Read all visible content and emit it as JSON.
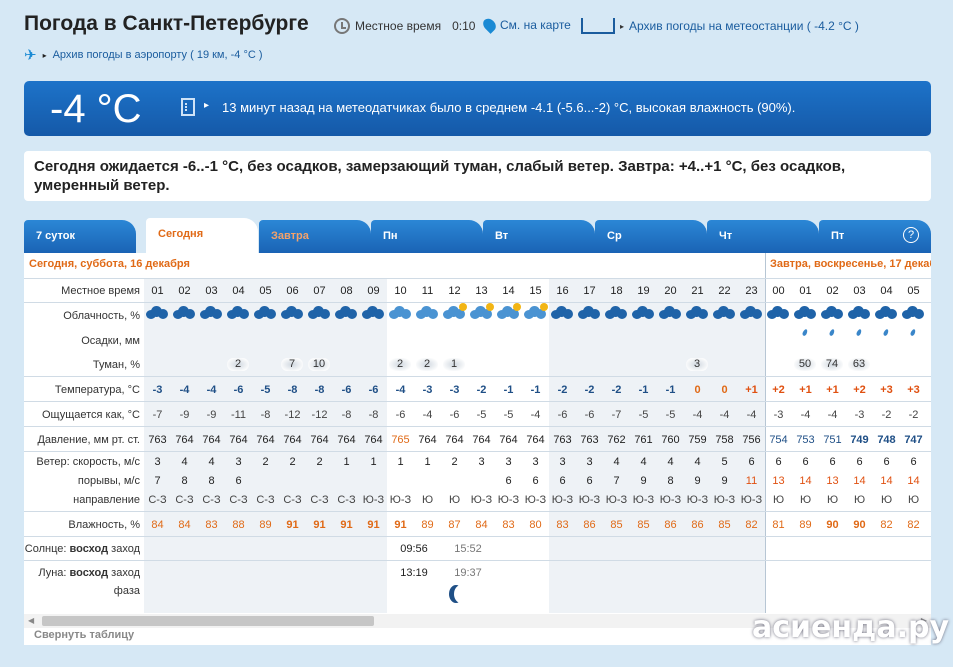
{
  "header": {
    "title": "Погода в Санкт-Петербурге",
    "local_time_label": "Местное время",
    "local_time": "0:10",
    "map_link": "См. на карте",
    "station_link": "Архив погоды на метеостанции ( -4.2 °C )",
    "airport_link": "Архив погоды в аэропорту ( 19 км, -4 °C )"
  },
  "current": {
    "temp": "-4 °C",
    "note": "13 минут назад на метеодатчиках было в среднем -4.1 (-5.6...-2) °C, высокая влажность (90%)."
  },
  "forecast_text": "Сегодня ожидается -6..-1 °C, без осадков, замерзающий туман, слабый ветер. Завтра: +4..+1 °C, без осадков, умеренный ветер.",
  "tabs": [
    "7 суток",
    "Сегодня",
    "Завтра",
    "Пн",
    "Вт",
    "Ср",
    "Чт",
    "Пт"
  ],
  "help": "?",
  "day1_label": "Сегодня, суббота, 16 декабря",
  "day2_label": "Завтра, воскресенье, 17 декабря",
  "row_labels": {
    "time": "Местное время",
    "cloud": "Облачность, %",
    "precip": "Осадки, мм",
    "fog": "Туман, %",
    "temp": "Температура, °С",
    "feels": "Ощущается как, °С",
    "pressure": "Давление, мм рт. ст.",
    "wind": "Ветер: скорость, м/с",
    "gusts": "порывы, м/с",
    "direction": "направление",
    "humidity": "Влажность, %",
    "sun_prefix": "Солнце:",
    "sun_rise": "восход",
    "sun_set": "заход",
    "moon_prefix": "Луна:",
    "moon_rise": "восход",
    "moon_set": "заход",
    "phase": "фаза"
  },
  "hours": [
    "01",
    "02",
    "03",
    "04",
    "05",
    "06",
    "07",
    "08",
    "09",
    "10",
    "11",
    "12",
    "13",
    "14",
    "15",
    "16",
    "17",
    "18",
    "19",
    "20",
    "21",
    "22",
    "23",
    "00",
    "01",
    "02",
    "03",
    "04",
    "05"
  ],
  "fog": [
    "",
    "",
    "",
    "2",
    "",
    "7",
    "10",
    "",
    "",
    "2",
    "2",
    "1",
    "",
    "",
    "",
    "",
    "",
    "",
    "",
    "",
    "3",
    "",
    "",
    "",
    "50",
    "74",
    "63",
    "",
    ""
  ],
  "temp": [
    "-3",
    "-4",
    "-4",
    "-6",
    "-5",
    "-8",
    "-8",
    "-6",
    "-6",
    "-4",
    "-3",
    "-3",
    "-2",
    "-1",
    "-1",
    "-2",
    "-2",
    "-2",
    "-1",
    "-1",
    "0",
    "0",
    "+1",
    "+2",
    "+1",
    "+1",
    "+2",
    "+3",
    "+3"
  ],
  "feels": [
    "-7",
    "-9",
    "-9",
    "-11",
    "-8",
    "-12",
    "-12",
    "-8",
    "-8",
    "-6",
    "-4",
    "-6",
    "-5",
    "-5",
    "-4",
    "-6",
    "-6",
    "-7",
    "-5",
    "-5",
    "-4",
    "-4",
    "-4",
    "-3",
    "-4",
    "-4",
    "-3",
    "-2",
    "-2"
  ],
  "pressure": [
    "763",
    "764",
    "764",
    "764",
    "764",
    "764",
    "764",
    "764",
    "764",
    "765",
    "764",
    "764",
    "764",
    "764",
    "764",
    "763",
    "763",
    "762",
    "761",
    "760",
    "759",
    "758",
    "756",
    "754",
    "753",
    "751",
    "749",
    "748",
    "747"
  ],
  "wind": [
    "3",
    "4",
    "4",
    "3",
    "2",
    "2",
    "2",
    "1",
    "1",
    "1",
    "1",
    "2",
    "3",
    "3",
    "3",
    "3",
    "3",
    "4",
    "4",
    "4",
    "4",
    "5",
    "6",
    "6",
    "6",
    "6",
    "6",
    "6",
    "6"
  ],
  "gusts": [
    "7",
    "8",
    "8",
    "6",
    "",
    "",
    "",
    "",
    "",
    "",
    "",
    "",
    "",
    "6",
    "6",
    "6",
    "6",
    "7",
    "9",
    "8",
    "9",
    "9",
    "11",
    "13",
    "14",
    "13",
    "14",
    "14",
    "14"
  ],
  "direction": [
    "С-З",
    "С-З",
    "С-З",
    "С-З",
    "С-З",
    "С-З",
    "С-З",
    "С-З",
    "Ю-З",
    "Ю-З",
    "Ю",
    "Ю",
    "Ю-З",
    "Ю-З",
    "Ю-З",
    "Ю-З",
    "Ю-З",
    "Ю-З",
    "Ю-З",
    "Ю-З",
    "Ю-З",
    "Ю-З",
    "Ю-З",
    "Ю",
    "Ю",
    "Ю",
    "Ю",
    "Ю",
    "Ю"
  ],
  "humidity": [
    "84",
    "84",
    "83",
    "88",
    "89",
    "91",
    "91",
    "91",
    "91",
    "91",
    "89",
    "87",
    "84",
    "83",
    "80",
    "83",
    "86",
    "85",
    "85",
    "86",
    "86",
    "85",
    "82",
    "81",
    "89",
    "90",
    "90",
    "82",
    "82"
  ],
  "sun": {
    "rise": "09:56",
    "set": "15:52"
  },
  "moon": {
    "rise": "13:19",
    "set": "19:37"
  },
  "collapse": "Свернуть таблицу",
  "watermark": "асиенда.ру"
}
